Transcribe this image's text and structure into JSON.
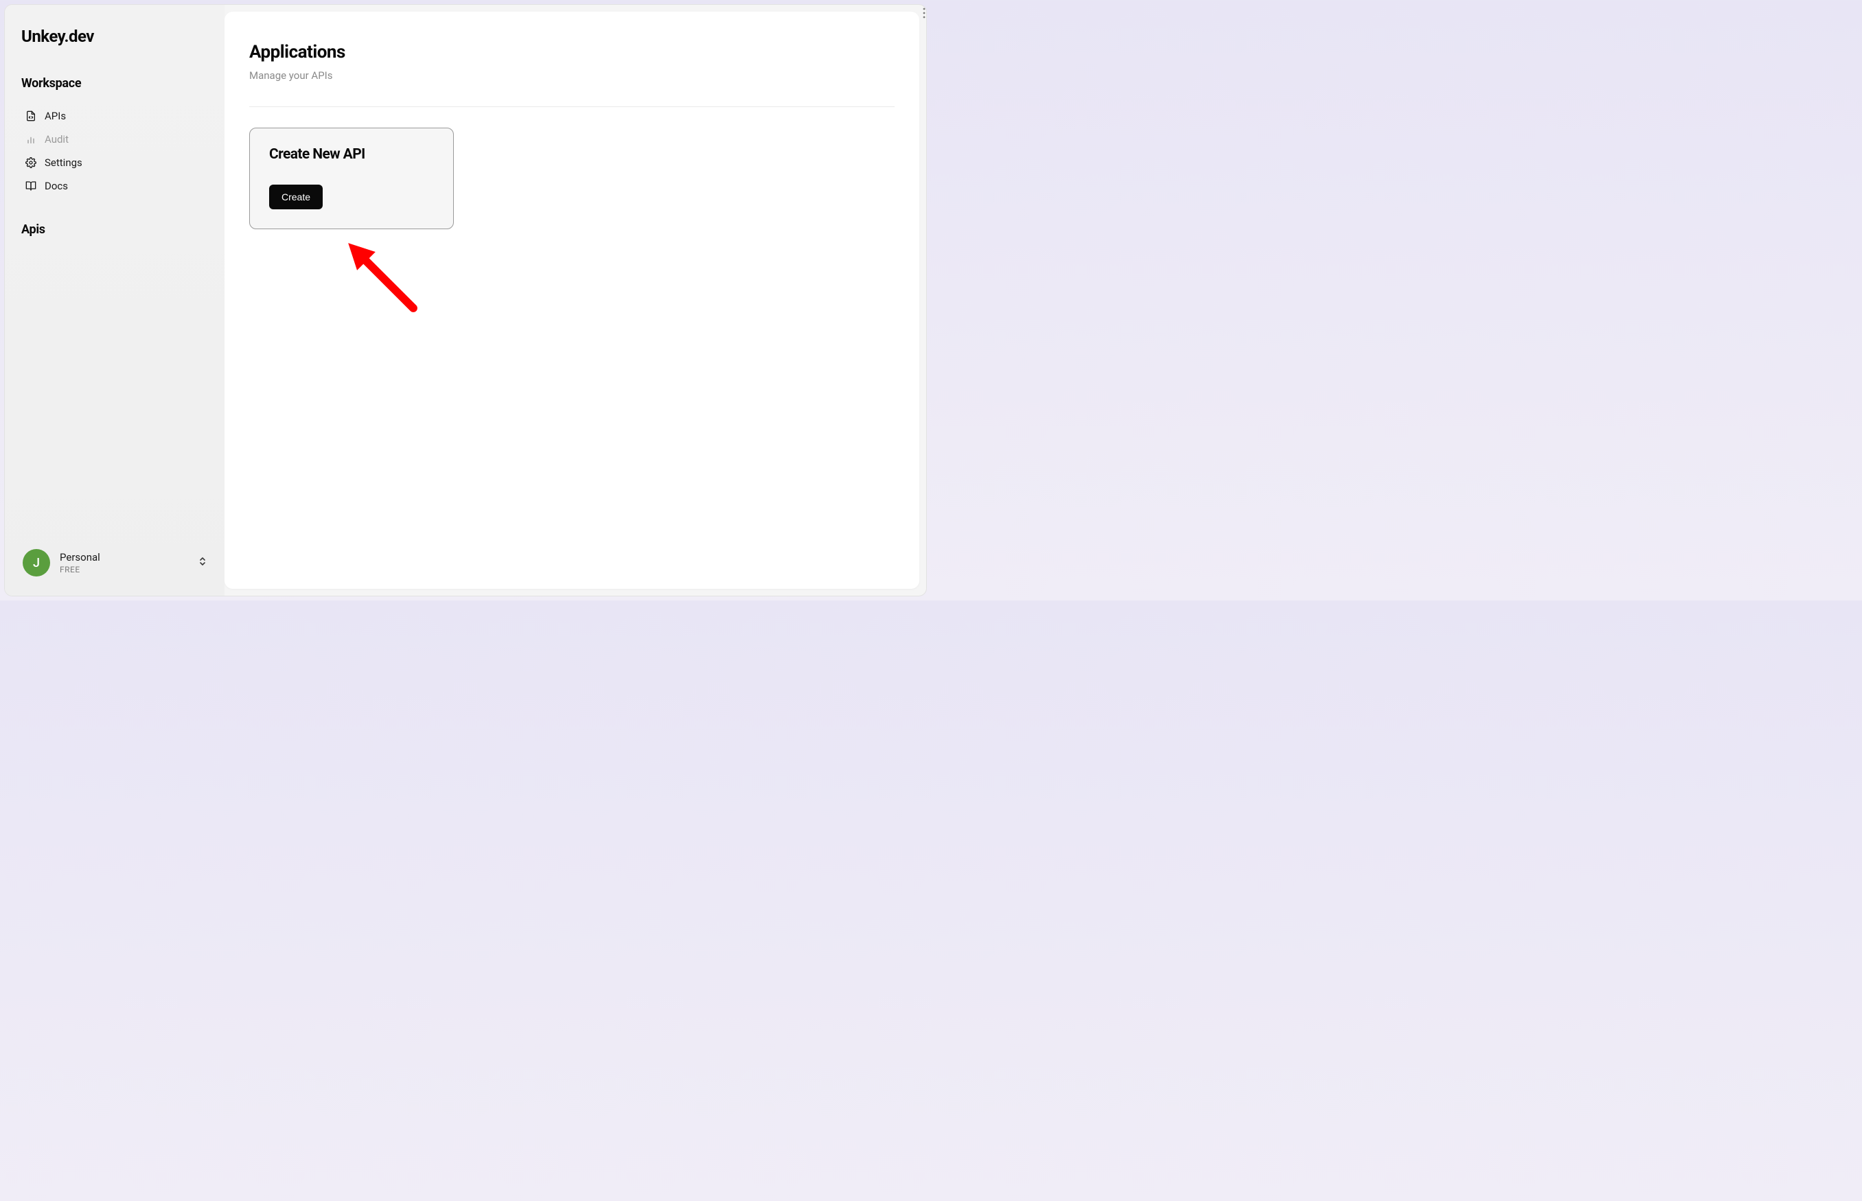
{
  "brand": "Unkey.dev",
  "sidebar": {
    "section_workspace": "Workspace",
    "section_apis": "Apis",
    "nav": {
      "apis": "APIs",
      "audit": "Audit",
      "settings": "Settings",
      "docs": "Docs"
    }
  },
  "user": {
    "initial": "J",
    "name": "Personal",
    "plan": "FREE"
  },
  "main": {
    "title": "Applications",
    "subtitle": "Manage your APIs",
    "card": {
      "title": "Create New API",
      "button_label": "Create"
    }
  }
}
